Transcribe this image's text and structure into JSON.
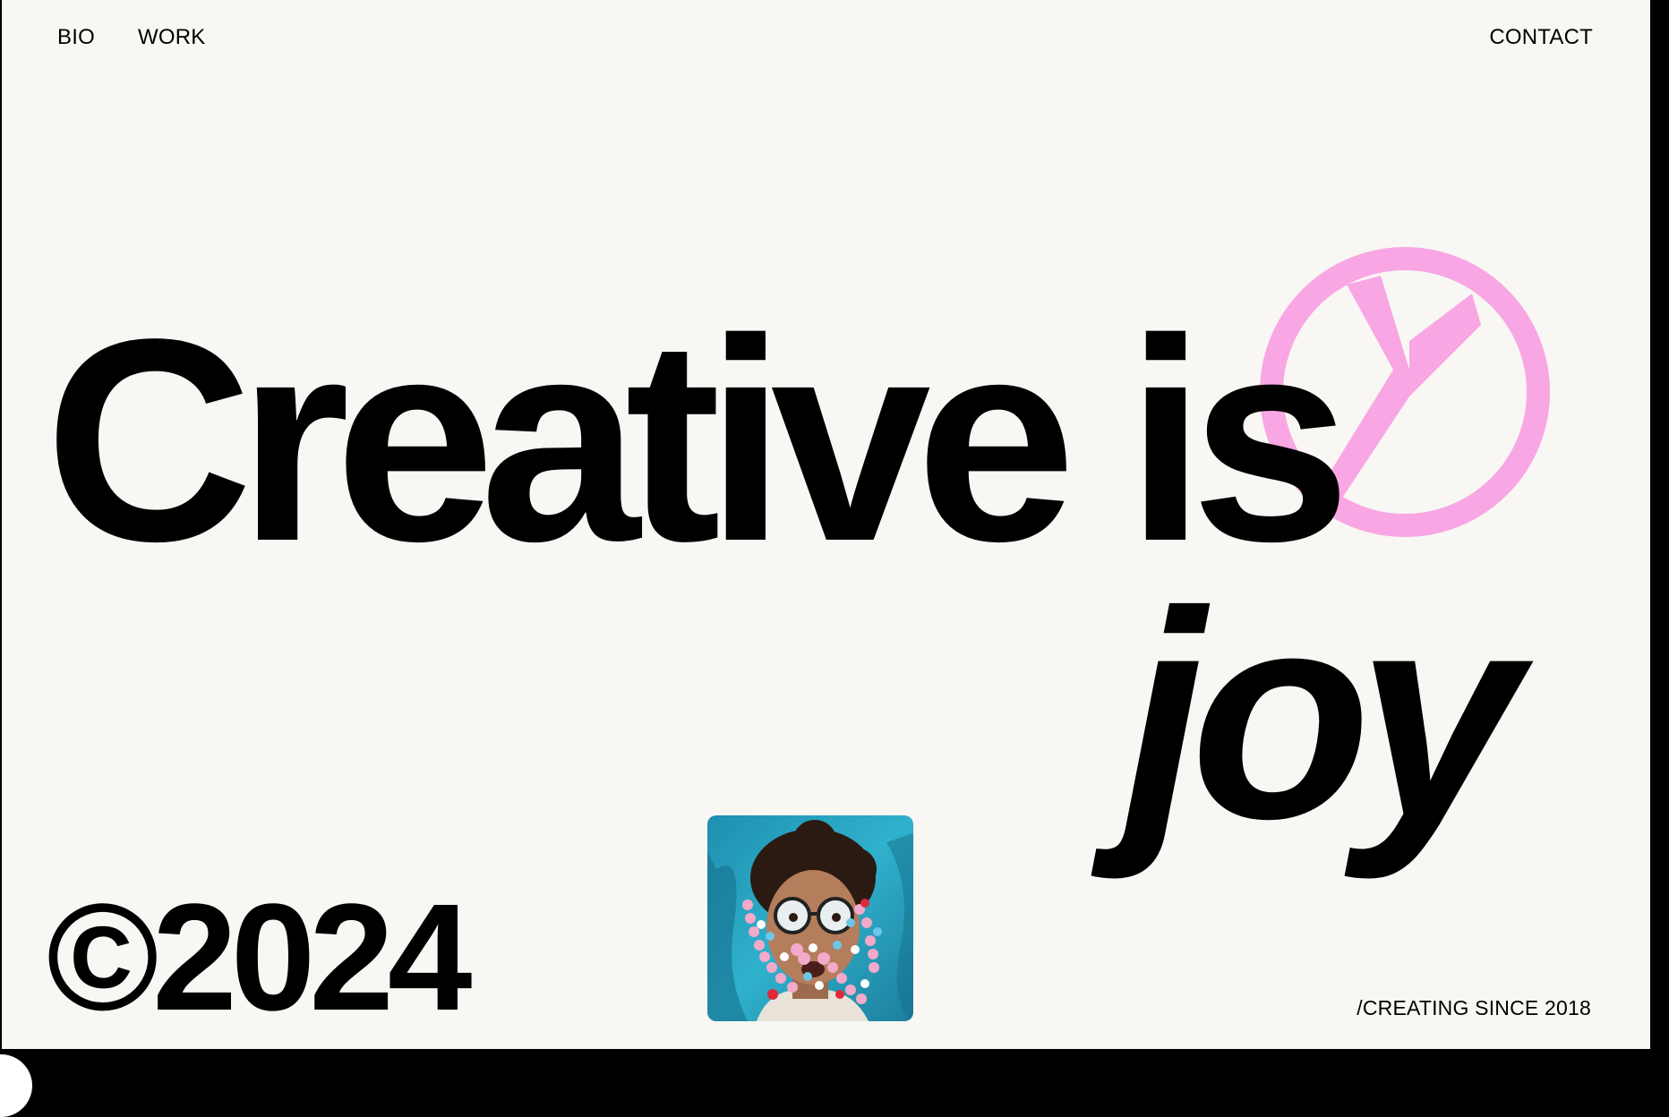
{
  "nav": {
    "bio": "BIO",
    "work": "WORK",
    "contact": "CONTACT"
  },
  "hero": {
    "line1": "Creative is",
    "line2": "joy"
  },
  "footer": {
    "copyright": "©2024",
    "tagline": "/CREATING SINCE 2018"
  },
  "icons": {
    "logo": "peace-y-logo-icon",
    "portrait": "portrait-photo"
  },
  "colors": {
    "background": "#f8f7f3",
    "text": "#000000",
    "accent": "#f9a6e4",
    "photo_backdrop": "#2aa7c4"
  }
}
